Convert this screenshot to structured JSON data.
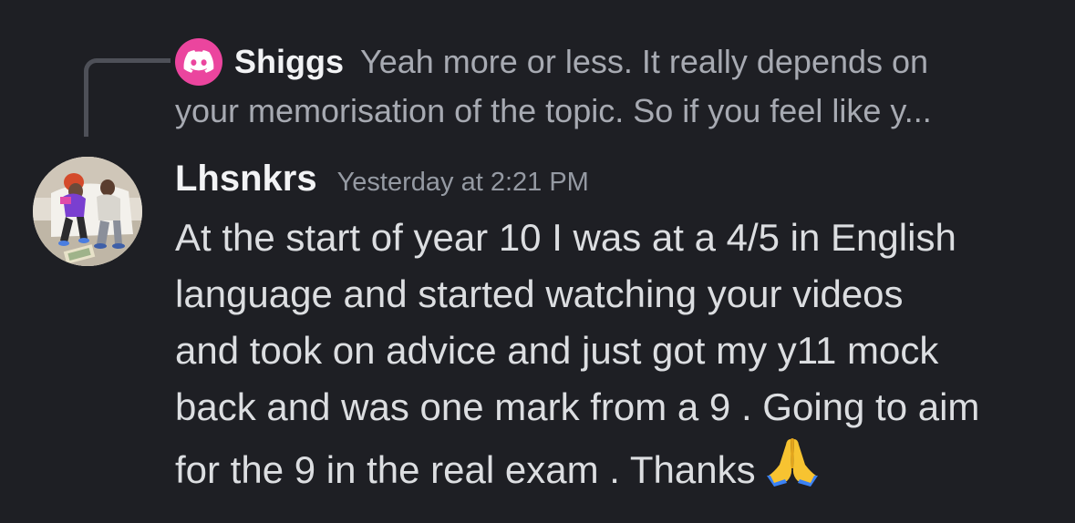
{
  "reply": {
    "author": "Shiggs",
    "text_line1": "Yeah more or less. It really depends on",
    "text_line2": "your memorisation of the topic. So if you feel like y...",
    "avatar_icon": "discord-logo-icon",
    "avatar_color": "#eb459e"
  },
  "message": {
    "author": "Lhsnkrs",
    "timestamp": "Yesterday at 2:21 PM",
    "avatar_icon": "user-photo-avatar",
    "lines": [
      "At the start of year 10 I was at a 4/5 in English",
      "language  and started watching your videos",
      "and took on advice and just got my y11 mock",
      "back and was one mark from a 9 . Going to aim",
      "for the 9 in the real exam . Thanks"
    ],
    "emoji": "folded-hands-emoji"
  },
  "colors": {
    "background": "#1e1f24",
    "text": "#dcdee1",
    "muted": "#a7aab2",
    "username": "#f2f3f5",
    "timestamp": "#959aa3",
    "reply_spine": "#4e5058"
  }
}
